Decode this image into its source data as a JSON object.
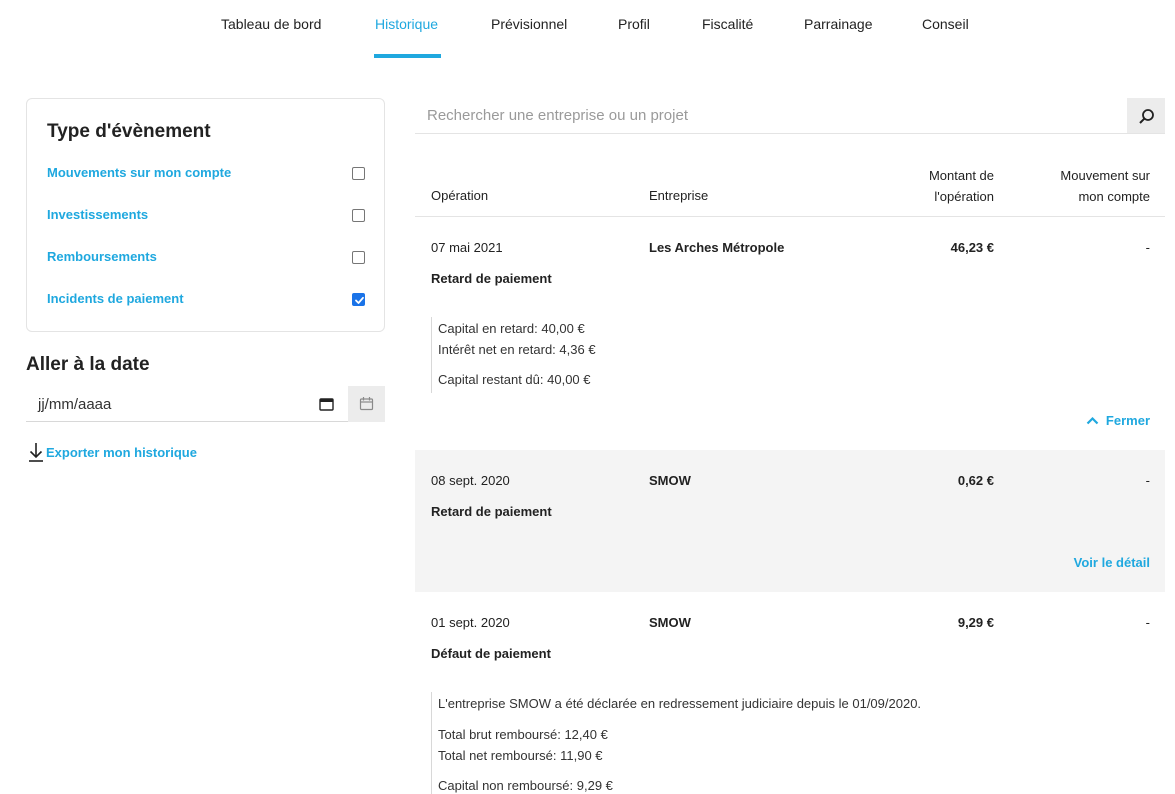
{
  "nav": {
    "tabs": [
      {
        "label": "Tableau de bord"
      },
      {
        "label": "Historique"
      },
      {
        "label": "Prévisionnel"
      },
      {
        "label": "Profil"
      },
      {
        "label": "Fiscalité"
      },
      {
        "label": "Parrainage"
      },
      {
        "label": "Conseil"
      }
    ],
    "active_tab": "Historique"
  },
  "filters": {
    "title": "Type d'évènement",
    "items": [
      {
        "label": "Mouvements sur mon compte",
        "checked": false
      },
      {
        "label": "Investissements",
        "checked": false
      },
      {
        "label": "Remboursements",
        "checked": false
      },
      {
        "label": "Incidents de paiement",
        "checked": true
      }
    ]
  },
  "date": {
    "title": "Aller à la date",
    "placeholder": "jj/mm/aaaa",
    "calendar_icon": "calendar-icon"
  },
  "export": {
    "label": "Exporter mon historique",
    "icon": "download-icon"
  },
  "search": {
    "placeholder": "Rechercher une entreprise ou un projet",
    "icon": "search-icon"
  },
  "table": {
    "headers": {
      "operation": "Opération",
      "company": "Entreprise",
      "amount_line1": "Montant de",
      "amount_line2": "l'opération",
      "movement_line1": "Mouvement sur",
      "movement_line2": "mon compte"
    },
    "rows": [
      {
        "date": "07 mai 2021",
        "type": "Retard de paiement",
        "company": "Les Arches Métropole",
        "amount": "46,23 €",
        "movement": "-",
        "details": [
          "Capital en retard: 40,00 €",
          "Intérêt net en retard: 4,36 €",
          "Capital restant dû: 40,00 €"
        ],
        "toggle": "Fermer"
      },
      {
        "date": "08 sept. 2020",
        "type": "Retard de paiement",
        "company": "SMOW",
        "amount": "0,62 €",
        "movement": "-",
        "toggle": "Voir le détail"
      },
      {
        "date": "01 sept. 2020",
        "type": "Défaut de paiement",
        "company": "SMOW",
        "amount": "9,29 €",
        "movement": "-",
        "details": [
          "L'entreprise SMOW a été déclarée en redressement judiciaire depuis le 01/09/2020.",
          "Total brut remboursé: 12,40 €",
          "Total net remboursé: 11,90 €",
          "Capital non remboursé: 9,29 €"
        ]
      }
    ]
  },
  "colors": {
    "accent": "#1fa8df",
    "checkbox_checked": "#1a73e8",
    "row_highlight": "#f4f4f4"
  }
}
